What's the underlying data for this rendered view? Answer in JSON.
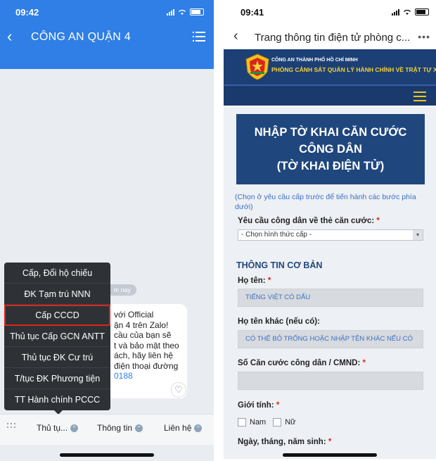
{
  "left_phone": {
    "status_time": "09:42",
    "header_title": "CÔNG AN QUẬN 4",
    "date_pill": "m nay",
    "message_lines": [
      "với Official",
      "ận 4 trên Zalo!",
      "cầu của bạn sẽ",
      "t và bảo mật theo",
      "ách, hãy liên hệ",
      "điện thoại đường",
      "0188"
    ],
    "menu_items": [
      "Cấp, Đổi hộ chiếu",
      "ĐK Tạm trú NNN",
      "Cấp CCCD",
      "Thủ tục Cấp GCN ANTT",
      "Thủ tục ĐK Cư trú",
      "T/tục ĐK Phương tiện",
      "TT Hành chính PCCC"
    ],
    "highlighted_item": "Cấp CCCD",
    "bottom_tabs": [
      "Thủ tụ...",
      "Thông tin",
      "Liên hệ"
    ]
  },
  "right_phone": {
    "status_time": "09:41",
    "nav_title": "Trang thông tin điện tử phòng c...",
    "banner_line1": "CÔNG AN THÀNH PHỐ HỒ CHÍ MINH",
    "banner_line2": "PHÒNG CẢNH SÁT QUẢN LÝ HÀNH CHÍNH VỀ TRẬT TỰ XÃ HỘI",
    "heading_lines": [
      "NHẬP TỜ KHAI CĂN CƯỚC",
      "CÔNG DÂN",
      "(TỜ KHAI ĐIỆN TỬ)"
    ],
    "hint": "(Chọn ở yêu cầu cấp trước để tiến hành các bước phía dưới)",
    "request_label": "Yêu cầu công dân về thẻ căn cước:",
    "select_value": "- Chọn hình thức cấp -",
    "section_title": "THÔNG TIN CƠ BẢN",
    "fullname_label": "Họ tên:",
    "fullname_placeholder": "TIẾNG VIỆT CÓ DẤU",
    "othername_label": "Họ tên khác (nếu có):",
    "othername_placeholder": "CÓ THỂ BỎ TRỐNG HOẶC NHẬP TÊN KHÁC NẾU CÓ",
    "id_label": "Số Căn cước công dân / CMND:",
    "gender_label": "Giới tính:",
    "gender_options": [
      "Nam",
      "Nữ"
    ],
    "dob_label_partial": "Ngày, tháng, năm sinh:",
    "required_mark": "*"
  },
  "colors": {
    "zalo_blue": "#2f7fe6",
    "menu_bg": "#2e3236",
    "highlight_red": "#d9261c",
    "navy": "#1f477e",
    "gold": "#f4d23c"
  }
}
